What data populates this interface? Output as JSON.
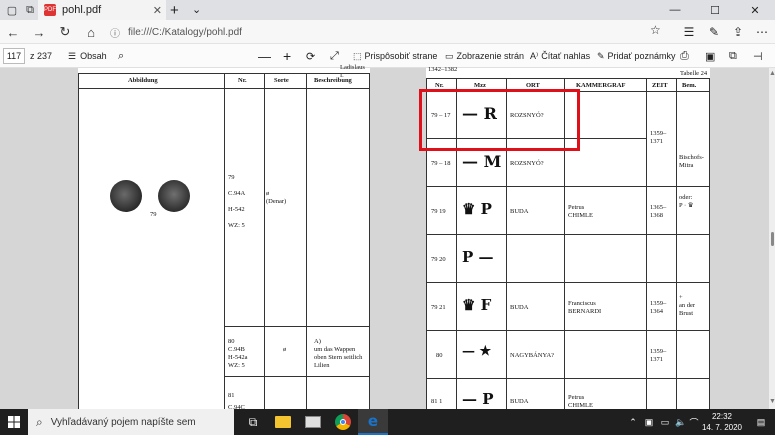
{
  "browser": {
    "tab_title": "pohl.pdf",
    "new_tab": "+",
    "url_info": "ⓘ",
    "url": "file:///C:/Katalogy/pohl.pdf"
  },
  "pdf_toolbar": {
    "page_current": "117",
    "page_total": "z 237",
    "contents": "Obsah",
    "fit_page": "Prispôsobiť strane",
    "page_view": "Zobrazenie strán",
    "read_aloud": "Čítať nahlas",
    "add_notes": "Pridať poznámky"
  },
  "left_page": {
    "header_top": "Ladislaus I.",
    "columns": [
      "Abbildung",
      "Nr.",
      "Sorte",
      "Beschreibung"
    ],
    "coin_number": "79",
    "row79_nr": [
      "79",
      "C.94A",
      "H-542",
      "WZ: 5"
    ],
    "row79_sorte": [
      "ø",
      "(Denar)"
    ],
    "row80_nr": [
      "80",
      "C.94B",
      "H-542a",
      "WZ: 5"
    ],
    "row80_sorte": "ø",
    "row80_desc": [
      "A)",
      "um das Wappen",
      "oben Stern seitlich",
      "Lilien"
    ],
    "row81_nr": [
      "81",
      "C.94C"
    ]
  },
  "right_page": {
    "header_top": "1342–1382",
    "table_label": "Tabelle 24",
    "columns": [
      "Nr.",
      "Mzz",
      "ORT",
      "KAMMERGRAF",
      "ZEIT",
      "Bem."
    ],
    "rows": [
      {
        "nr": "79 – 17",
        "mzz": "—  R",
        "ort": "ROZSNYÓ?",
        "kammergraf": "",
        "zeit": "",
        "bem": ""
      },
      {
        "nr": "79 – 18",
        "mzz": "—  M",
        "ort": "ROZSNYÓ?",
        "kammergraf": "",
        "zeit": "1359–\n1371",
        "bem": "Bischofs-\nMitra"
      },
      {
        "nr": "79   19",
        "mzz": "♛  P",
        "ort": "BUDA",
        "kammergraf": "Petrus\nCHIMLE",
        "zeit": "1365–\n1368",
        "bem": "oder:\nP · ♛"
      },
      {
        "nr": "79   20",
        "mzz": "P  —",
        "ort": "",
        "kammergraf": "",
        "zeit": "",
        "bem": ""
      },
      {
        "nr": "79   21",
        "mzz": "♛  F",
        "ort": "BUDA",
        "kammergraf": "Franciscus\nBERNARDI",
        "zeit": "1359–\n1364",
        "bem": "+\nan der\nBrust"
      },
      {
        "nr": "80",
        "mzz": "— ★",
        "ort": "NAGYBÁNYA?",
        "kammergraf": "",
        "zeit": "1359–\n1371",
        "bem": ""
      },
      {
        "nr": "81   1",
        "mzz": "—  P",
        "ort": "BUDA",
        "kammergraf": "Petrus\nCHIMLE",
        "zeit": "",
        "bem": ""
      }
    ]
  },
  "taskbar": {
    "search_placeholder": "Vyhľadávaný pojem napíšte sem",
    "time": "22:32",
    "date": "14. 7. 2020"
  },
  "colors": {
    "highlight": "#e0101a",
    "taskbar": "#1f1f1f",
    "edge_blue": "#1a73c8"
  }
}
